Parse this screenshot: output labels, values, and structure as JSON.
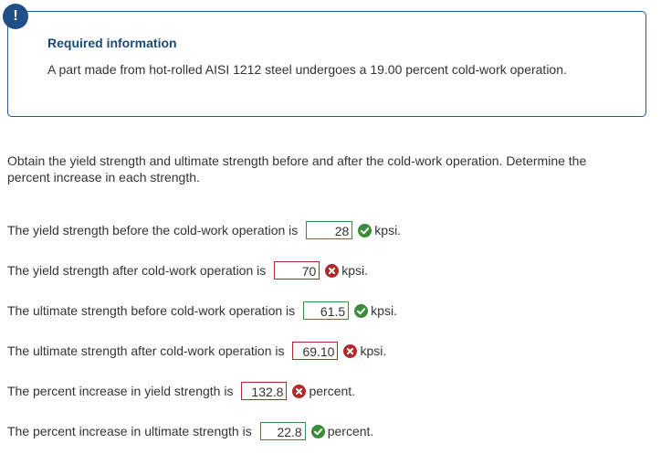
{
  "info": {
    "badge": "!",
    "title": "Required information",
    "text": "A part made from hot-rolled AISI 1212 steel undergoes a 19.00 percent cold-work operation."
  },
  "intro": {
    "line1": "Obtain the yield strength and ultimate strength before and after the cold-work operation. Determine the",
    "line2": "percent increase in each strength."
  },
  "questions": [
    {
      "label": "The yield strength before the cold-work operation is",
      "value": "28",
      "status": "correct",
      "icon": "check-circle-icon",
      "unit": "kpsi."
    },
    {
      "label": "The yield strength after cold-work operation is",
      "value": "70",
      "status": "incorrect",
      "icon": "x-circle-icon",
      "unit": "kpsi."
    },
    {
      "label": "The ultimate strength before cold-work operation is",
      "value": "61.5",
      "status": "correct",
      "icon": "check-circle-icon",
      "unit": "kpsi."
    },
    {
      "label": "The ultimate strength after cold-work operation is",
      "value": "69.10",
      "status": "incorrect",
      "icon": "x-circle-icon",
      "unit": "kpsi."
    },
    {
      "label": "The percent increase in yield strength is",
      "value": "132.8",
      "status": "incorrect",
      "icon": "x-circle-icon",
      "unit": "percent."
    },
    {
      "label": "The percent increase in ultimate strength is",
      "value": "22.8",
      "status": "correct",
      "icon": "check-circle-icon",
      "unit": "percent."
    }
  ],
  "colors": {
    "correct": "#3a8b3a",
    "incorrect": "#b02a2a",
    "accent": "#1f4f86"
  }
}
